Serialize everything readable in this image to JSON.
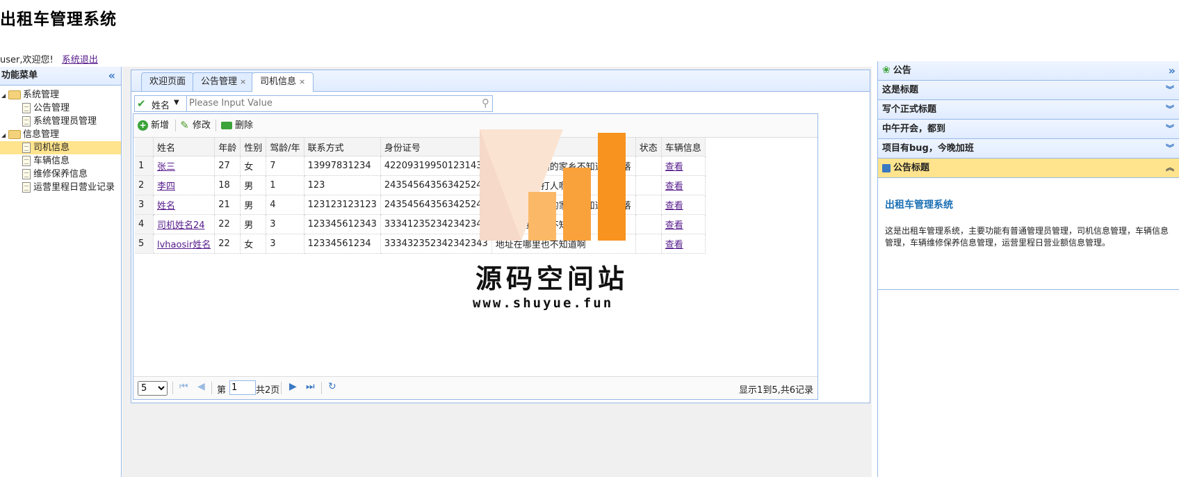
{
  "app": {
    "title": "出租车管理系统"
  },
  "userbar": {
    "greeting": "user,欢迎您!",
    "logout": "系统退出"
  },
  "menu": {
    "title": "功能菜单",
    "groups": [
      {
        "label": "系统管理",
        "items": [
          "公告管理",
          "系统管理员管理"
        ]
      },
      {
        "label": "信息管理",
        "items": [
          "司机信息",
          "车辆信息",
          "维修保养信息",
          "运营里程日营业记录"
        ]
      }
    ],
    "selected": "司机信息"
  },
  "tabs": [
    {
      "label": "欢迎页面"
    },
    {
      "label": "公告管理",
      "close": "×"
    },
    {
      "label": "司机信息",
      "close": "×"
    }
  ],
  "search": {
    "field": "姓名",
    "placeholder": "Please Input Value"
  },
  "toolbar": {
    "add": "新增",
    "edit": "修改",
    "delete": "删除"
  },
  "table": {
    "columns": [
      "",
      "姓名",
      "年龄",
      "性别",
      "驾龄/年",
      "联系方式",
      "身份证号",
      "详细住址",
      "状态",
      "车辆信息"
    ],
    "rows": [
      {
        "no": "1",
        "name": "张三",
        "age": "27",
        "gender": "女",
        "years": "7",
        "phone": "13997831234",
        "id": "422093199501231432",
        "addr": "地址在很遥远的家乡不知道的角落",
        "status": "",
        "car": "查看"
      },
      {
        "no": "2",
        "name": "李四",
        "age": "18",
        "gender": "男",
        "years": "1",
        "phone": "123",
        "id": "243545643563425242",
        "addr": "就很难受的打人啊长",
        "status": "",
        "car": "查看"
      },
      {
        "no": "3",
        "name": "姓名",
        "age": "21",
        "gender": "男",
        "years": "4",
        "phone": "123123123123",
        "id": "243545643563425242",
        "addr": "地址在很遥远的家乡不知道的角落",
        "status": "",
        "car": "查看"
      },
      {
        "no": "4",
        "name": "司机姓名24",
        "age": "22",
        "gender": "男",
        "years": "3",
        "phone": "123345612343",
        "id": "333412352342342343",
        "addr": "地址在哪里也不知道啊",
        "status": "",
        "car": "查看"
      },
      {
        "no": "5",
        "name": "lvhaosir姓名",
        "age": "22",
        "gender": "女",
        "years": "3",
        "phone": "12334561234",
        "id": "333432352342342343",
        "addr": "地址在哪里也不知道啊",
        "status": "",
        "car": "查看"
      }
    ]
  },
  "pager": {
    "page_size": "5",
    "page_prefix": "第",
    "page": "1",
    "total_pages": "共2页",
    "info": "显示1到5,共6记录"
  },
  "notice": {
    "title": "公告",
    "items": [
      "这是标题",
      "写个正式标题",
      "中午开会，都到",
      "项目有bug，今晚加班"
    ],
    "open_item": "公告标题",
    "content_title": "出租车管理系统",
    "content_text": "这是出租车管理系统，主要功能有普通管理员管理，司机信息管理，车辆信息管理，车辆维修保养信息管理，运营里程日营业额信息管理。"
  },
  "watermark": {
    "text": "源码空间站",
    "url": "www.shuyue.fun"
  },
  "colors": {
    "border": "#95b8e7",
    "header": "#e0ecff",
    "selected": "#ffe48d",
    "watermark_orange": "#f7931e"
  }
}
